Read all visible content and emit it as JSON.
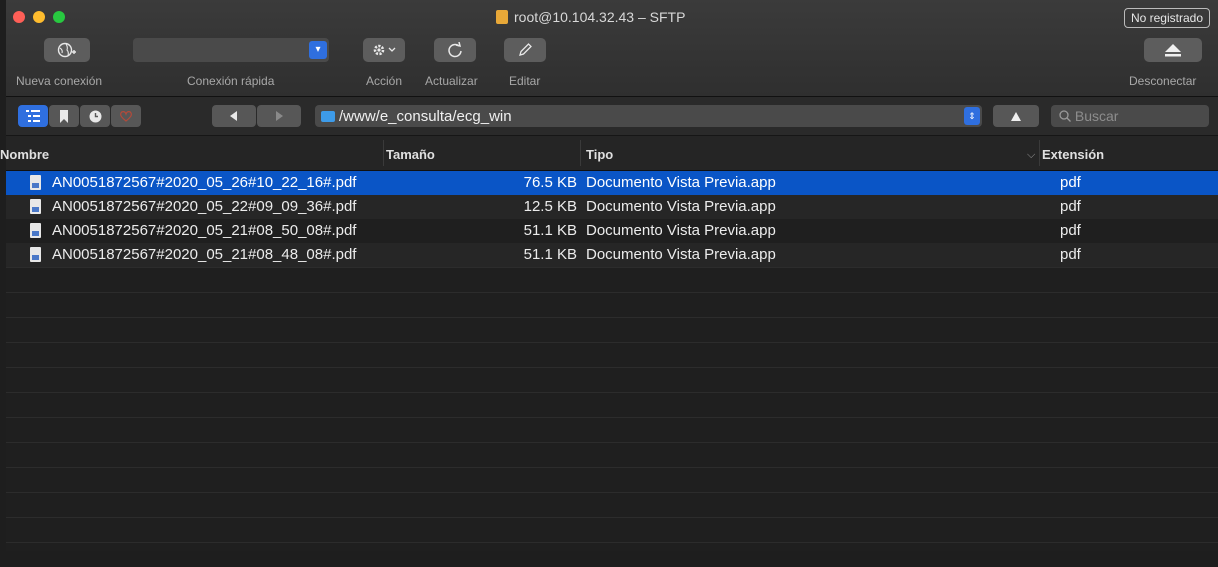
{
  "window": {
    "title": "root@10.104.32.43 – SFTP",
    "badge": "No registrado"
  },
  "toolbar": {
    "new_connection": "Nueva conexión",
    "quick_connect": "Conexión rápida",
    "action": "Acción",
    "refresh": "Actualizar",
    "edit": "Editar",
    "disconnect": "Desconectar"
  },
  "pathbar": {
    "path": "/www/e_consulta/ecg_win",
    "search_placeholder": "Buscar"
  },
  "table": {
    "columns": [
      "Nombre",
      "Tamaño",
      "Tipo",
      "Extensión"
    ],
    "rows": [
      {
        "name": "AN0051872567#2020_05_26#10_22_16#.pdf",
        "size": "76.5 KB",
        "type": "Documento Vista Previa.app",
        "ext": "pdf",
        "selected": true
      },
      {
        "name": "AN0051872567#2020_05_22#09_09_36#.pdf",
        "size": "12.5 KB",
        "type": "Documento Vista Previa.app",
        "ext": "pdf",
        "selected": false
      },
      {
        "name": "AN0051872567#2020_05_21#08_50_08#.pdf",
        "size": "51.1 KB",
        "type": "Documento Vista Previa.app",
        "ext": "pdf",
        "selected": false
      },
      {
        "name": "AN0051872567#2020_05_21#08_48_08#.pdf",
        "size": "51.1 KB",
        "type": "Documento Vista Previa.app",
        "ext": "pdf",
        "selected": false
      }
    ]
  },
  "colors": {
    "selection": "#0a55c6",
    "accent": "#2f6fdf"
  }
}
